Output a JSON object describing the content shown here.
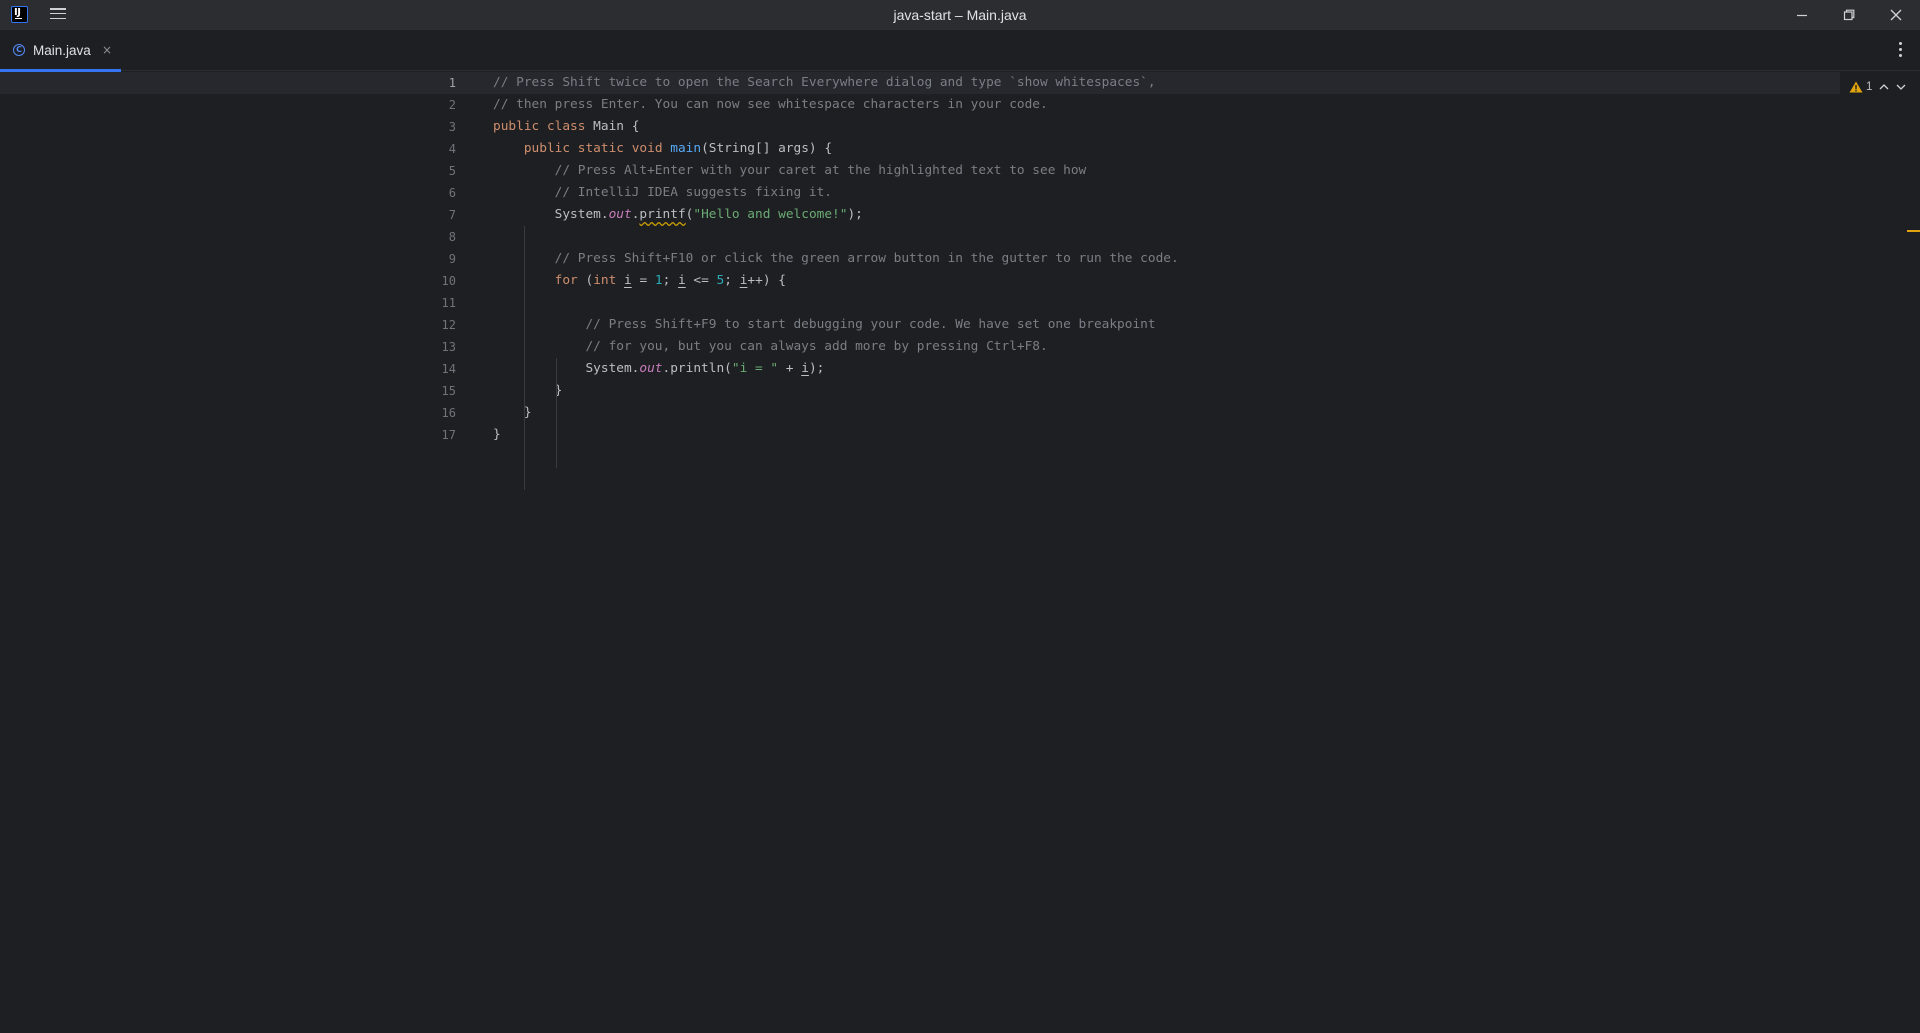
{
  "window": {
    "title": "java-start – Main.java",
    "logo_text": "IJ"
  },
  "tabs": [
    {
      "label": "Main.java",
      "icon": "java-class-icon",
      "icon_glyph": "C",
      "close_glyph": "×"
    }
  ],
  "colors": {
    "accent": "#3574f0",
    "warning": "#e0a30f"
  },
  "inspection": {
    "warnings": "1"
  },
  "editor": {
    "active_line": 1,
    "lines": [
      {
        "number": "1",
        "tokens": [
          {
            "t": "// Press Shift twice to open the Search Everywhere dialog and type `show whitespaces`,",
            "c": "comment"
          }
        ]
      },
      {
        "number": "2",
        "tokens": [
          {
            "t": "// then press Enter. You can now see whitespace characters in your code.",
            "c": "comment"
          }
        ]
      },
      {
        "number": "3",
        "tokens": [
          {
            "t": "public ",
            "c": "kw"
          },
          {
            "t": "class ",
            "c": "kw"
          },
          {
            "t": "Main {",
            "c": ""
          }
        ]
      },
      {
        "number": "4",
        "tokens": [
          {
            "t": "    ",
            "c": ""
          },
          {
            "t": "public ",
            "c": "kw"
          },
          {
            "t": "static ",
            "c": "kw"
          },
          {
            "t": "void ",
            "c": "kw"
          },
          {
            "t": "main",
            "c": "fn"
          },
          {
            "t": "(String[] args) {",
            "c": ""
          }
        ]
      },
      {
        "number": "5",
        "tokens": [
          {
            "t": "        ",
            "c": ""
          },
          {
            "t": "// Press Alt+Enter with your caret at the highlighted text to see how",
            "c": "comment"
          }
        ]
      },
      {
        "number": "6",
        "tokens": [
          {
            "t": "        ",
            "c": ""
          },
          {
            "t": "// IntelliJ IDEA suggests fixing it.",
            "c": "comment"
          }
        ]
      },
      {
        "number": "7",
        "tokens": [
          {
            "t": "        System.",
            "c": ""
          },
          {
            "t": "out",
            "c": "field"
          },
          {
            "t": ".",
            "c": ""
          },
          {
            "t": "printf",
            "c": "warn"
          },
          {
            "t": "(",
            "c": ""
          },
          {
            "t": "\"Hello and welcome!\"",
            "c": "str"
          },
          {
            "t": ");",
            "c": ""
          }
        ]
      },
      {
        "number": "8",
        "tokens": []
      },
      {
        "number": "9",
        "tokens": [
          {
            "t": "        ",
            "c": ""
          },
          {
            "t": "// Press Shift+F10 or click the green arrow button in the gutter to run the code.",
            "c": "comment"
          }
        ]
      },
      {
        "number": "10",
        "tokens": [
          {
            "t": "        ",
            "c": ""
          },
          {
            "t": "for ",
            "c": "kw"
          },
          {
            "t": "(",
            "c": ""
          },
          {
            "t": "int ",
            "c": "kw"
          },
          {
            "t": "i",
            "c": "var"
          },
          {
            "t": " = ",
            "c": ""
          },
          {
            "t": "1",
            "c": "num"
          },
          {
            "t": "; ",
            "c": ""
          },
          {
            "t": "i",
            "c": "var"
          },
          {
            "t": " <= ",
            "c": ""
          },
          {
            "t": "5",
            "c": "num"
          },
          {
            "t": "; ",
            "c": ""
          },
          {
            "t": "i",
            "c": "var"
          },
          {
            "t": "++) {",
            "c": ""
          }
        ]
      },
      {
        "number": "11",
        "tokens": []
      },
      {
        "number": "12",
        "tokens": [
          {
            "t": "            ",
            "c": ""
          },
          {
            "t": "// Press Shift+F9 to start debugging your code. We have set one breakpoint",
            "c": "comment"
          }
        ]
      },
      {
        "number": "13",
        "tokens": [
          {
            "t": "            ",
            "c": ""
          },
          {
            "t": "// for you, but you can always add more by pressing Ctrl+F8.",
            "c": "comment"
          }
        ]
      },
      {
        "number": "14",
        "tokens": [
          {
            "t": "            System.",
            "c": ""
          },
          {
            "t": "out",
            "c": "field"
          },
          {
            "t": ".println(",
            "c": ""
          },
          {
            "t": "\"i = \"",
            "c": "str"
          },
          {
            "t": " + ",
            "c": ""
          },
          {
            "t": "i",
            "c": "var"
          },
          {
            "t": ");",
            "c": ""
          }
        ]
      },
      {
        "number": "15",
        "tokens": [
          {
            "t": "        }",
            "c": ""
          }
        ]
      },
      {
        "number": "16",
        "tokens": [
          {
            "t": "    }",
            "c": ""
          }
        ]
      },
      {
        "number": "17",
        "tokens": [
          {
            "t": "}",
            "c": ""
          }
        ]
      }
    ]
  }
}
